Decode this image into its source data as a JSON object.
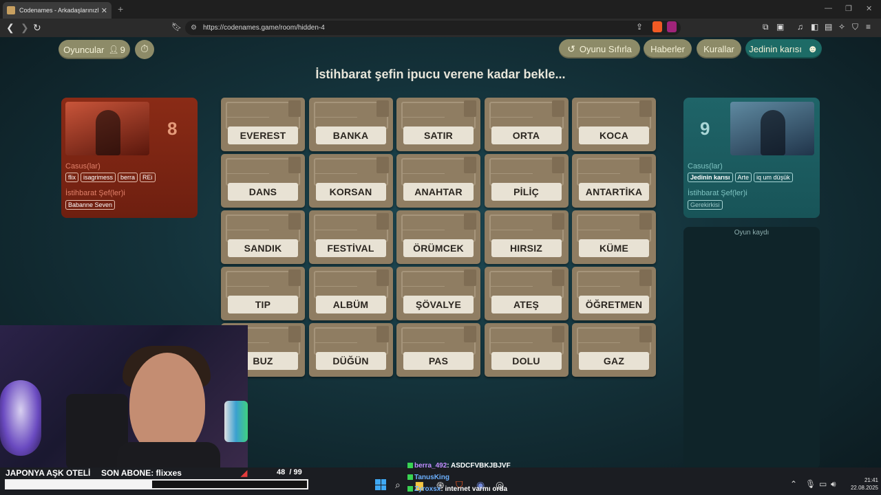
{
  "browser": {
    "tab_title": "Codenames - Arkadaşlarınızla çe",
    "tab_close": "✕",
    "new_tab": "+",
    "url": "https://codenames.game/room/hidden-4"
  },
  "topbar": {
    "players_label": "Oyuncular",
    "players_count": "9",
    "reset_label": "Oyunu Sıfırla",
    "news_label": "Haberler",
    "rules_label": "Kurallar",
    "user_label": "Jedinin karısı"
  },
  "status": {
    "message": "İstihbarat şefin ipucu verene kadar bekle..."
  },
  "red_team": {
    "remaining": "8",
    "operatives_label": "Casus(lar)",
    "operatives": [
      "flix",
      "isagrimess",
      "berra",
      "REi"
    ],
    "spymaster_label": "İstihbarat Şef(ler)i",
    "spymasters": [
      "Babanne Seven"
    ],
    "color": "#8a2b16"
  },
  "blue_team": {
    "remaining": "9",
    "operatives_label": "Casus(lar)",
    "operatives": [
      "Jedinin karısı",
      "Arte",
      "iq um düşük"
    ],
    "spymaster_label": "İstihbarat Şef(ler)i",
    "spymasters": [
      "Gerekirkisi"
    ],
    "color": "#1f6468"
  },
  "board": {
    "words": [
      "EVEREST",
      "BANKA",
      "SATIR",
      "ORTA",
      "KOCA",
      "DANS",
      "KORSAN",
      "ANAHTAR",
      "PİLİÇ",
      "ANTARTİKA",
      "SANDIK",
      "FESTİVAL",
      "ÖRÜMCEK",
      "HIRSIZ",
      "KÜME",
      "TIP",
      "ALBÜM",
      "ŞÖVALYE",
      "ATEŞ",
      "ÖĞRETMEN",
      "BUZ",
      "DÜĞÜN",
      "PAS",
      "DOLU",
      "GAZ"
    ]
  },
  "log": {
    "title": "Oyun kaydı"
  },
  "stream": {
    "left_text": "JAPONYA AŞK OTELİ",
    "sub_text": "SON ABONE: flixxes",
    "counter": "48  / 99",
    "progress": 0.485
  },
  "chat": [
    {
      "user": "berra_492",
      "msg": ": ASDCFVBKJBJVF"
    },
    {
      "user": "TanusKing",
      "msg": ""
    },
    {
      "user": "Zyroxsx",
      "msg": ": internet varmı orda"
    }
  ],
  "clock": {
    "time": "21:41",
    "date": "22.08.2025"
  },
  "icons": {
    "back": "back-arrow-icon",
    "forward": "forward-arrow-icon",
    "reload": "reload-icon",
    "timer": "stopwatch-icon",
    "reset": "undo-icon",
    "smile": "smiley-icon"
  }
}
